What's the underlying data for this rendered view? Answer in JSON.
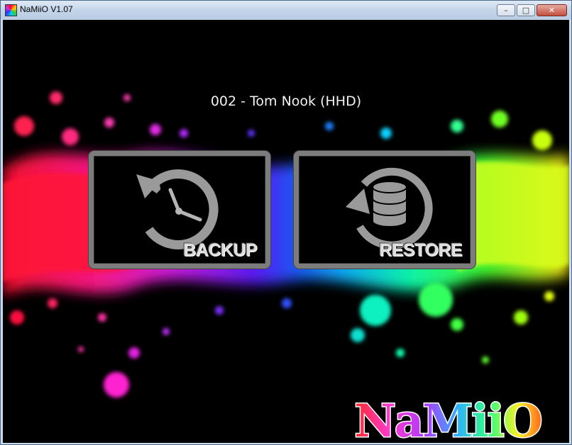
{
  "window": {
    "title": "NaMiiO V1.07",
    "controls": {
      "minimize": "–",
      "maximize": "□",
      "close": "✕"
    }
  },
  "main": {
    "title": "002 - Tom Nook (HHD)",
    "buttons": {
      "backup_label": "BACKUP",
      "restore_label": "RESTORE"
    }
  },
  "logo": {
    "text": "NaMiiO"
  },
  "icons": {
    "backup": "clock-counterclockwise-icon",
    "restore": "database-refresh-icon"
  },
  "colors": {
    "background": "#000000",
    "tile_border": "#7c7c7c",
    "icon_gray": "#9a9a9a"
  }
}
